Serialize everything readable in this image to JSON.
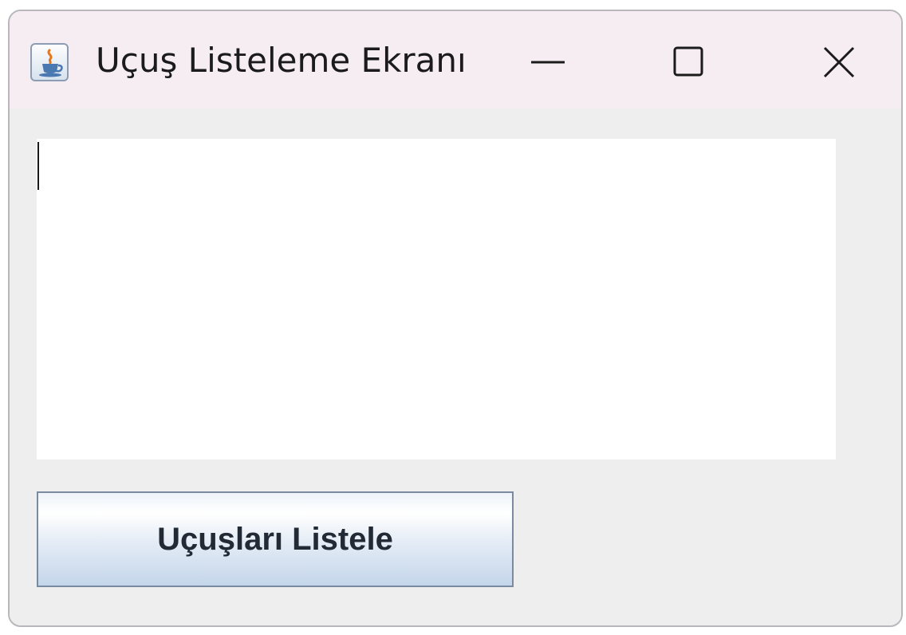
{
  "window": {
    "title": "Uçuş Listeleme Ekranı",
    "icon": "java-coffee-cup-icon"
  },
  "title_buttons": {
    "minimize_icon": "minimize-icon",
    "maximize_icon": "maximize-icon",
    "close_icon": "close-icon"
  },
  "text_area": {
    "value": ""
  },
  "actions": {
    "list_flights_label": "Uçuşları Listele"
  },
  "colors": {
    "titlebar_bg": "#f6edf2",
    "window_bg": "#eeeeee",
    "text_area_bg": "#ffffff",
    "button_border": "#7a8aa0",
    "button_gradient_bottom": "#c4d6ea"
  }
}
